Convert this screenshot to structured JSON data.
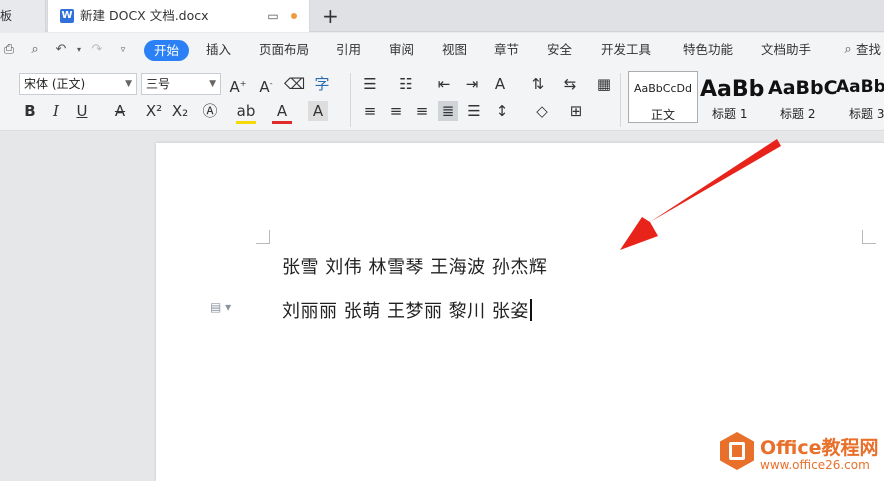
{
  "tabs": {
    "left_tab_label": "板",
    "active_tab_icon": "W",
    "active_tab_title": "新建 DOCX 文档.docx",
    "new_tab_symbol": "+"
  },
  "menu": {
    "items": [
      "开始",
      "插入",
      "页面布局",
      "引用",
      "审阅",
      "视图",
      "章节",
      "安全",
      "开发工具",
      "特色功能",
      "文档助手",
      "查找"
    ]
  },
  "ribbon": {
    "font_name": "宋体 (正文)",
    "font_size": "三号",
    "styles": [
      {
        "preview": "AaBbCcDd",
        "label": "正文"
      },
      {
        "preview": "AaBb",
        "label": "标题 1"
      },
      {
        "preview": "AaBbC",
        "label": "标题 2"
      },
      {
        "preview": "AaBb",
        "label": "标题 3"
      }
    ]
  },
  "document": {
    "line1": "张雪  刘伟  林雪琴  王海波  孙杰辉",
    "line2": "刘丽丽  张萌  王梦丽  黎川  张姿"
  },
  "colors": {
    "accent": "#2b80f5",
    "arrow": "#e8231a",
    "watermark": "#e8702a"
  },
  "watermark": {
    "brand": "Office教程网",
    "url": "www.office26.com"
  }
}
